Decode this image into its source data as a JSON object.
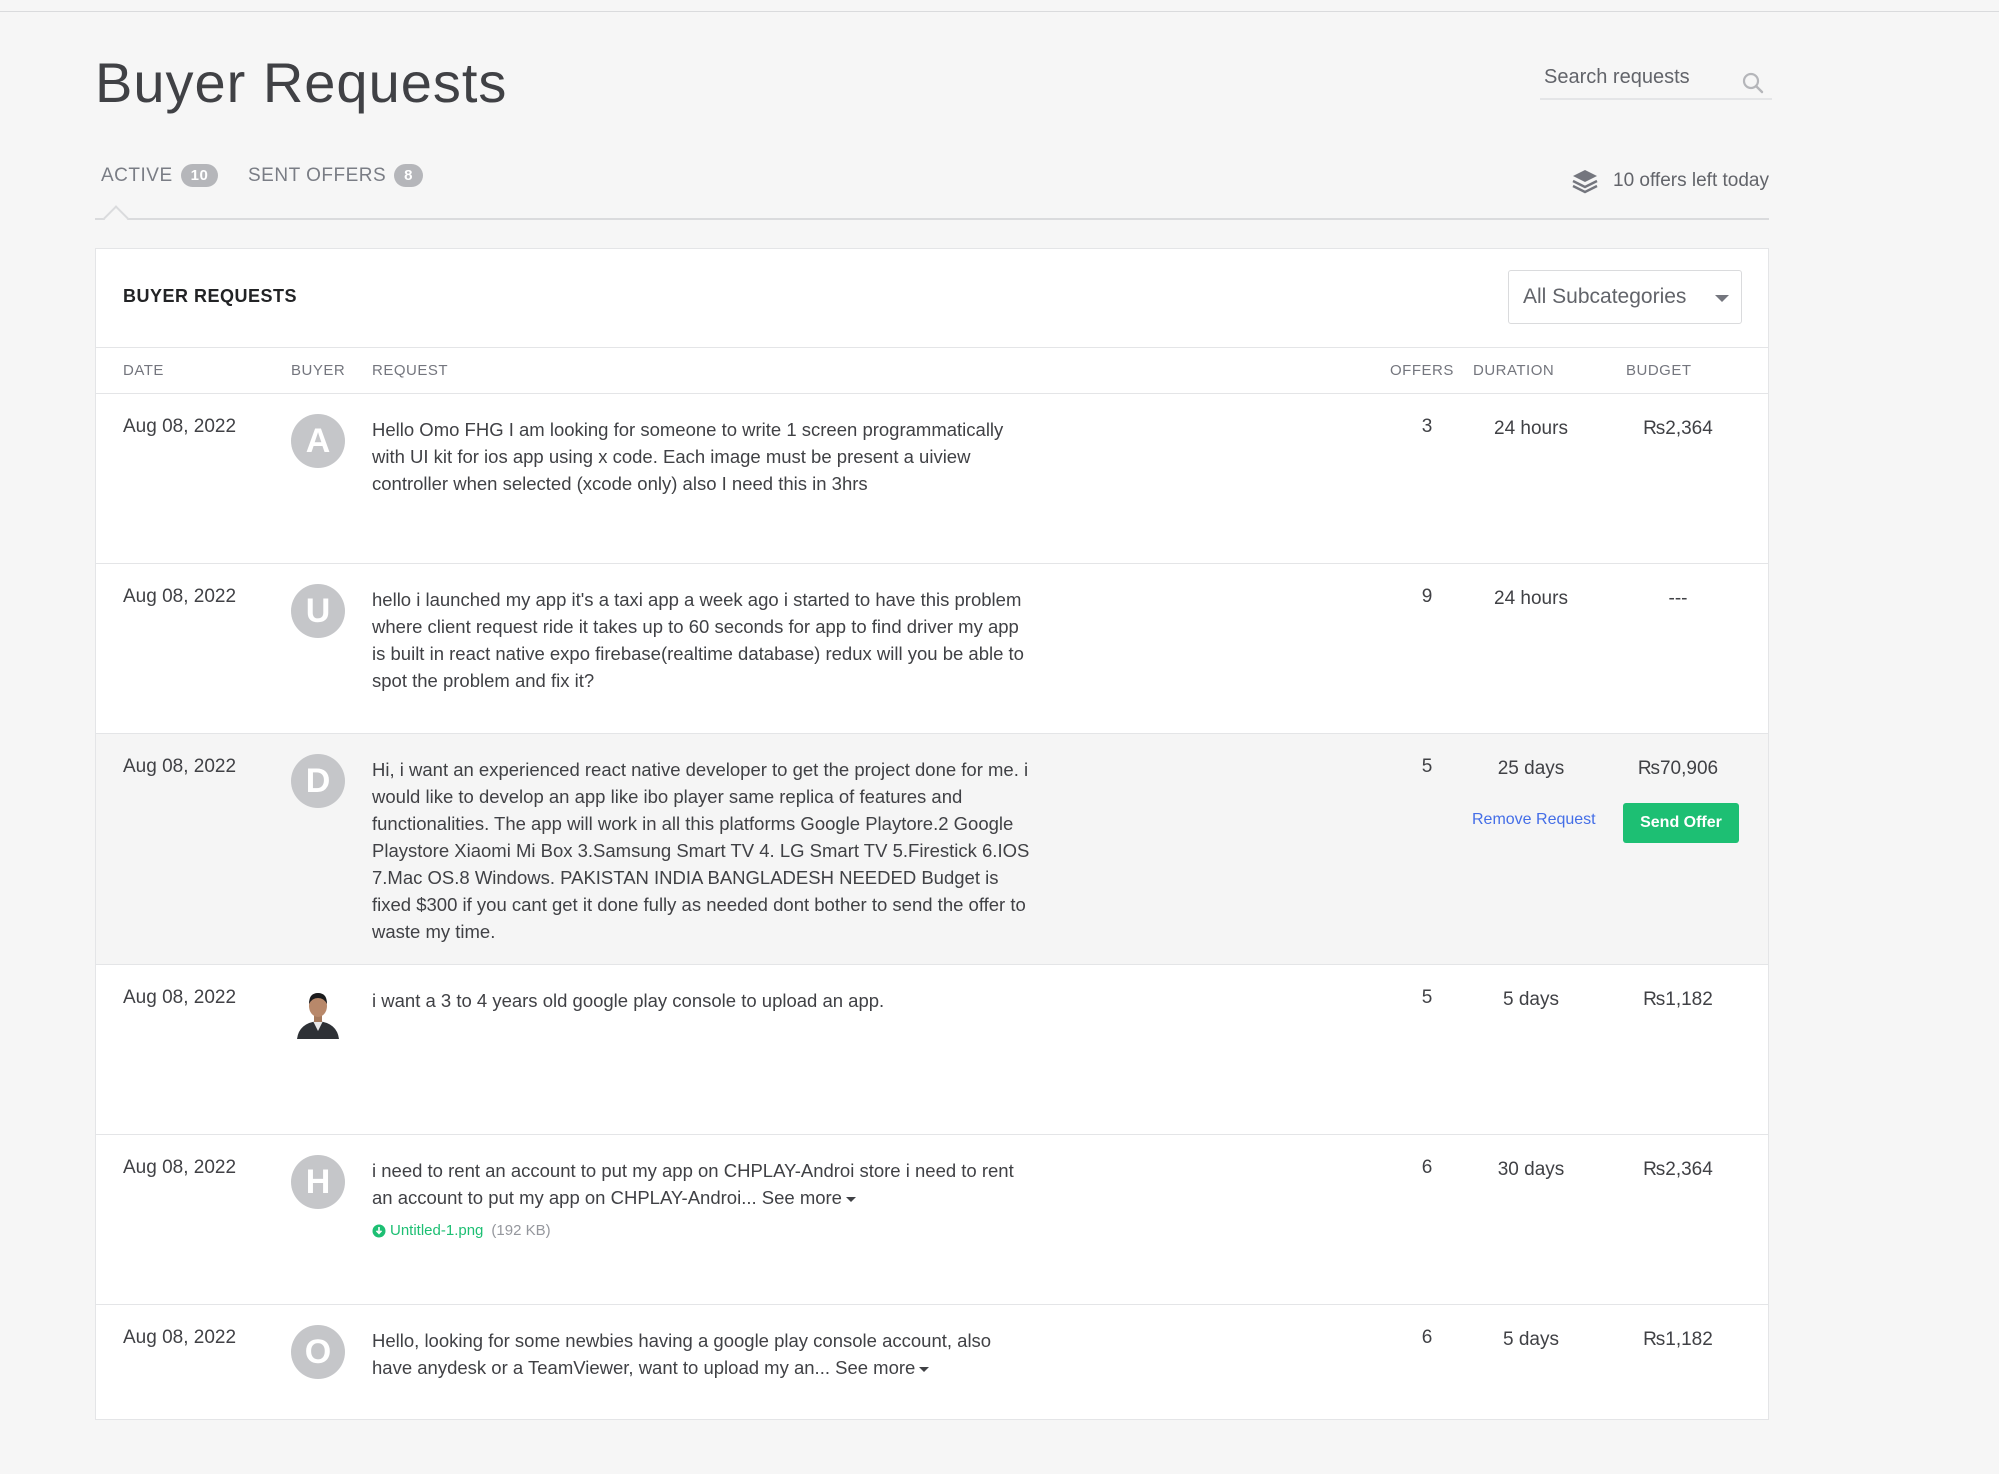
{
  "page": {
    "title": "Buyer Requests"
  },
  "search": {
    "placeholder": "Search requests"
  },
  "tabs": [
    {
      "label": "ACTIVE",
      "count": "10"
    },
    {
      "label": "SENT OFFERS",
      "count": "8"
    }
  ],
  "offers_left": "10 offers left today",
  "panel": {
    "title": "BUYER REQUESTS",
    "subcategory_selected": "All Subcategories"
  },
  "columns": {
    "date": "DATE",
    "buyer": "BUYER",
    "request": "REQUEST",
    "offers": "OFFERS",
    "duration": "DURATION",
    "budget": "BUDGET"
  },
  "rows": [
    {
      "date": "Aug 08, 2022",
      "avatar": "A",
      "request": "Hello Omo FHG I am looking for someone to write 1 screen programmatically with UI kit for ios app using x code. Each image must be present a uiview controller when selected (xcode only) also I need this in 3hrs",
      "offers": "3",
      "duration": "24 hours",
      "budget": "₨2,364"
    },
    {
      "date": "Aug 08, 2022",
      "avatar": "U",
      "request": "hello i launched my app it's a taxi app a week ago i started to have this problem where client request ride it takes up to 60 seconds for app to find driver my app is built in react native expo firebase(realtime database) redux will you be able to spot the problem and fix it?",
      "offers": "9",
      "duration": "24 hours",
      "budget": "---"
    },
    {
      "date": "Aug 08, 2022",
      "avatar": "D",
      "request": "Hi, i want an experienced react native developer to get the project done for me. i would like to develop an app like ibo player same replica of features and functionalities. The app will work in all this platforms Google Playtore.2 Google Playstore Xiaomi Mi Box 3.Samsung Smart TV 4. LG Smart TV 5.Firestick 6.IOS 7.Mac OS.8 Windows. PAKISTAN INDIA BANGLADESH NEEDED Budget is fixed $300 if you cant get it done fully as needed dont bother to send the offer to waste my time.",
      "offers": "5",
      "duration": "25 days",
      "budget": "₨70,906",
      "remove_label": "Remove Request",
      "send_label": "Send Offer"
    },
    {
      "date": "Aug 08, 2022",
      "avatar": "",
      "request": "i want a 3 to 4 years old google play console to upload an app.",
      "offers": "5",
      "duration": "5 days",
      "budget": "₨1,182"
    },
    {
      "date": "Aug 08, 2022",
      "avatar": "H",
      "request": "i need to rent an account to put my app on CHPLAY-Androi store i need to rent an account to put my app on CHPLAY-Androi...",
      "see_more": "See more",
      "attachment": {
        "name": "Untitled-1.png",
        "size": "(192 KB)"
      },
      "offers": "6",
      "duration": "30 days",
      "budget": "₨2,364"
    },
    {
      "date": "Aug 08, 2022",
      "avatar": "O",
      "request": "Hello, looking for some newbies having a google play console account, also have anydesk or a TeamViewer, want to upload my an...",
      "see_more": "See more",
      "offers": "6",
      "duration": "5 days",
      "budget": "₨1,182"
    }
  ]
}
